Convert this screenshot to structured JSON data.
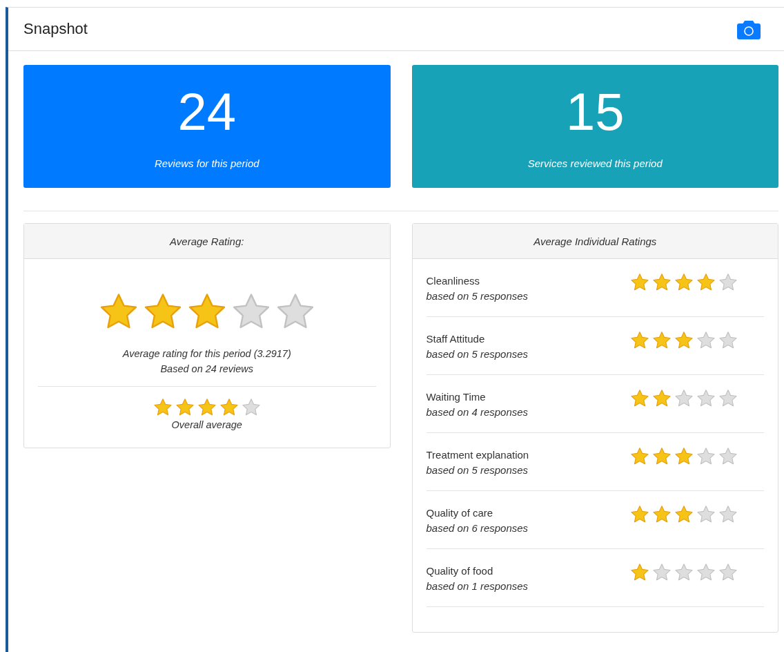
{
  "header": {
    "title": "Snapshot"
  },
  "stat_cards": [
    {
      "value": "24",
      "label": "Reviews for this period",
      "color": "#007bff"
    },
    {
      "value": "15",
      "label": "Services reviewed this period",
      "color": "#17a2b8"
    }
  ],
  "average_rating": {
    "title": "Average Rating:",
    "stars": 3,
    "summary": "Average rating for this period (3.2917)",
    "based_on": "Based on 24 reviews",
    "overall": {
      "stars": 4,
      "label": "Overall average"
    }
  },
  "individual_ratings": {
    "title": "Average Individual Ratings",
    "items": [
      {
        "name": "Cleanliness",
        "responses": "based on 5 responses",
        "stars": 4
      },
      {
        "name": "Staff Attitude",
        "responses": "based on 5 responses",
        "stars": 3
      },
      {
        "name": "Waiting Time",
        "responses": "based on 4 responses",
        "stars": 2
      },
      {
        "name": "Treatment explanation",
        "responses": "based on 5 responses",
        "stars": 3
      },
      {
        "name": "Quality of care",
        "responses": "based on 6 responses",
        "stars": 3
      },
      {
        "name": "Quality of food",
        "responses": "based on 1 responses",
        "stars": 1
      }
    ]
  }
}
